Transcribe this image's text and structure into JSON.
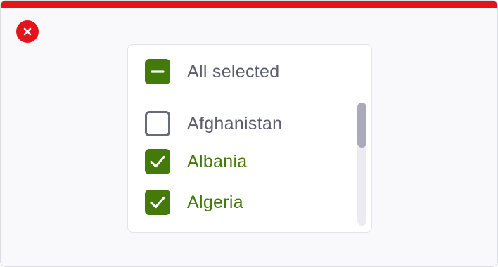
{
  "dialog": {
    "close_icon": "close-x-icon",
    "accent_color": "#e5141b"
  },
  "list": {
    "select_all": {
      "label": "All selected",
      "state": "indeterminate"
    },
    "items": [
      {
        "label": "Afghanistan",
        "checked": false
      },
      {
        "label": "Albania",
        "checked": true
      },
      {
        "label": "Algeria",
        "checked": true
      }
    ],
    "check_color": "#437a0a"
  }
}
